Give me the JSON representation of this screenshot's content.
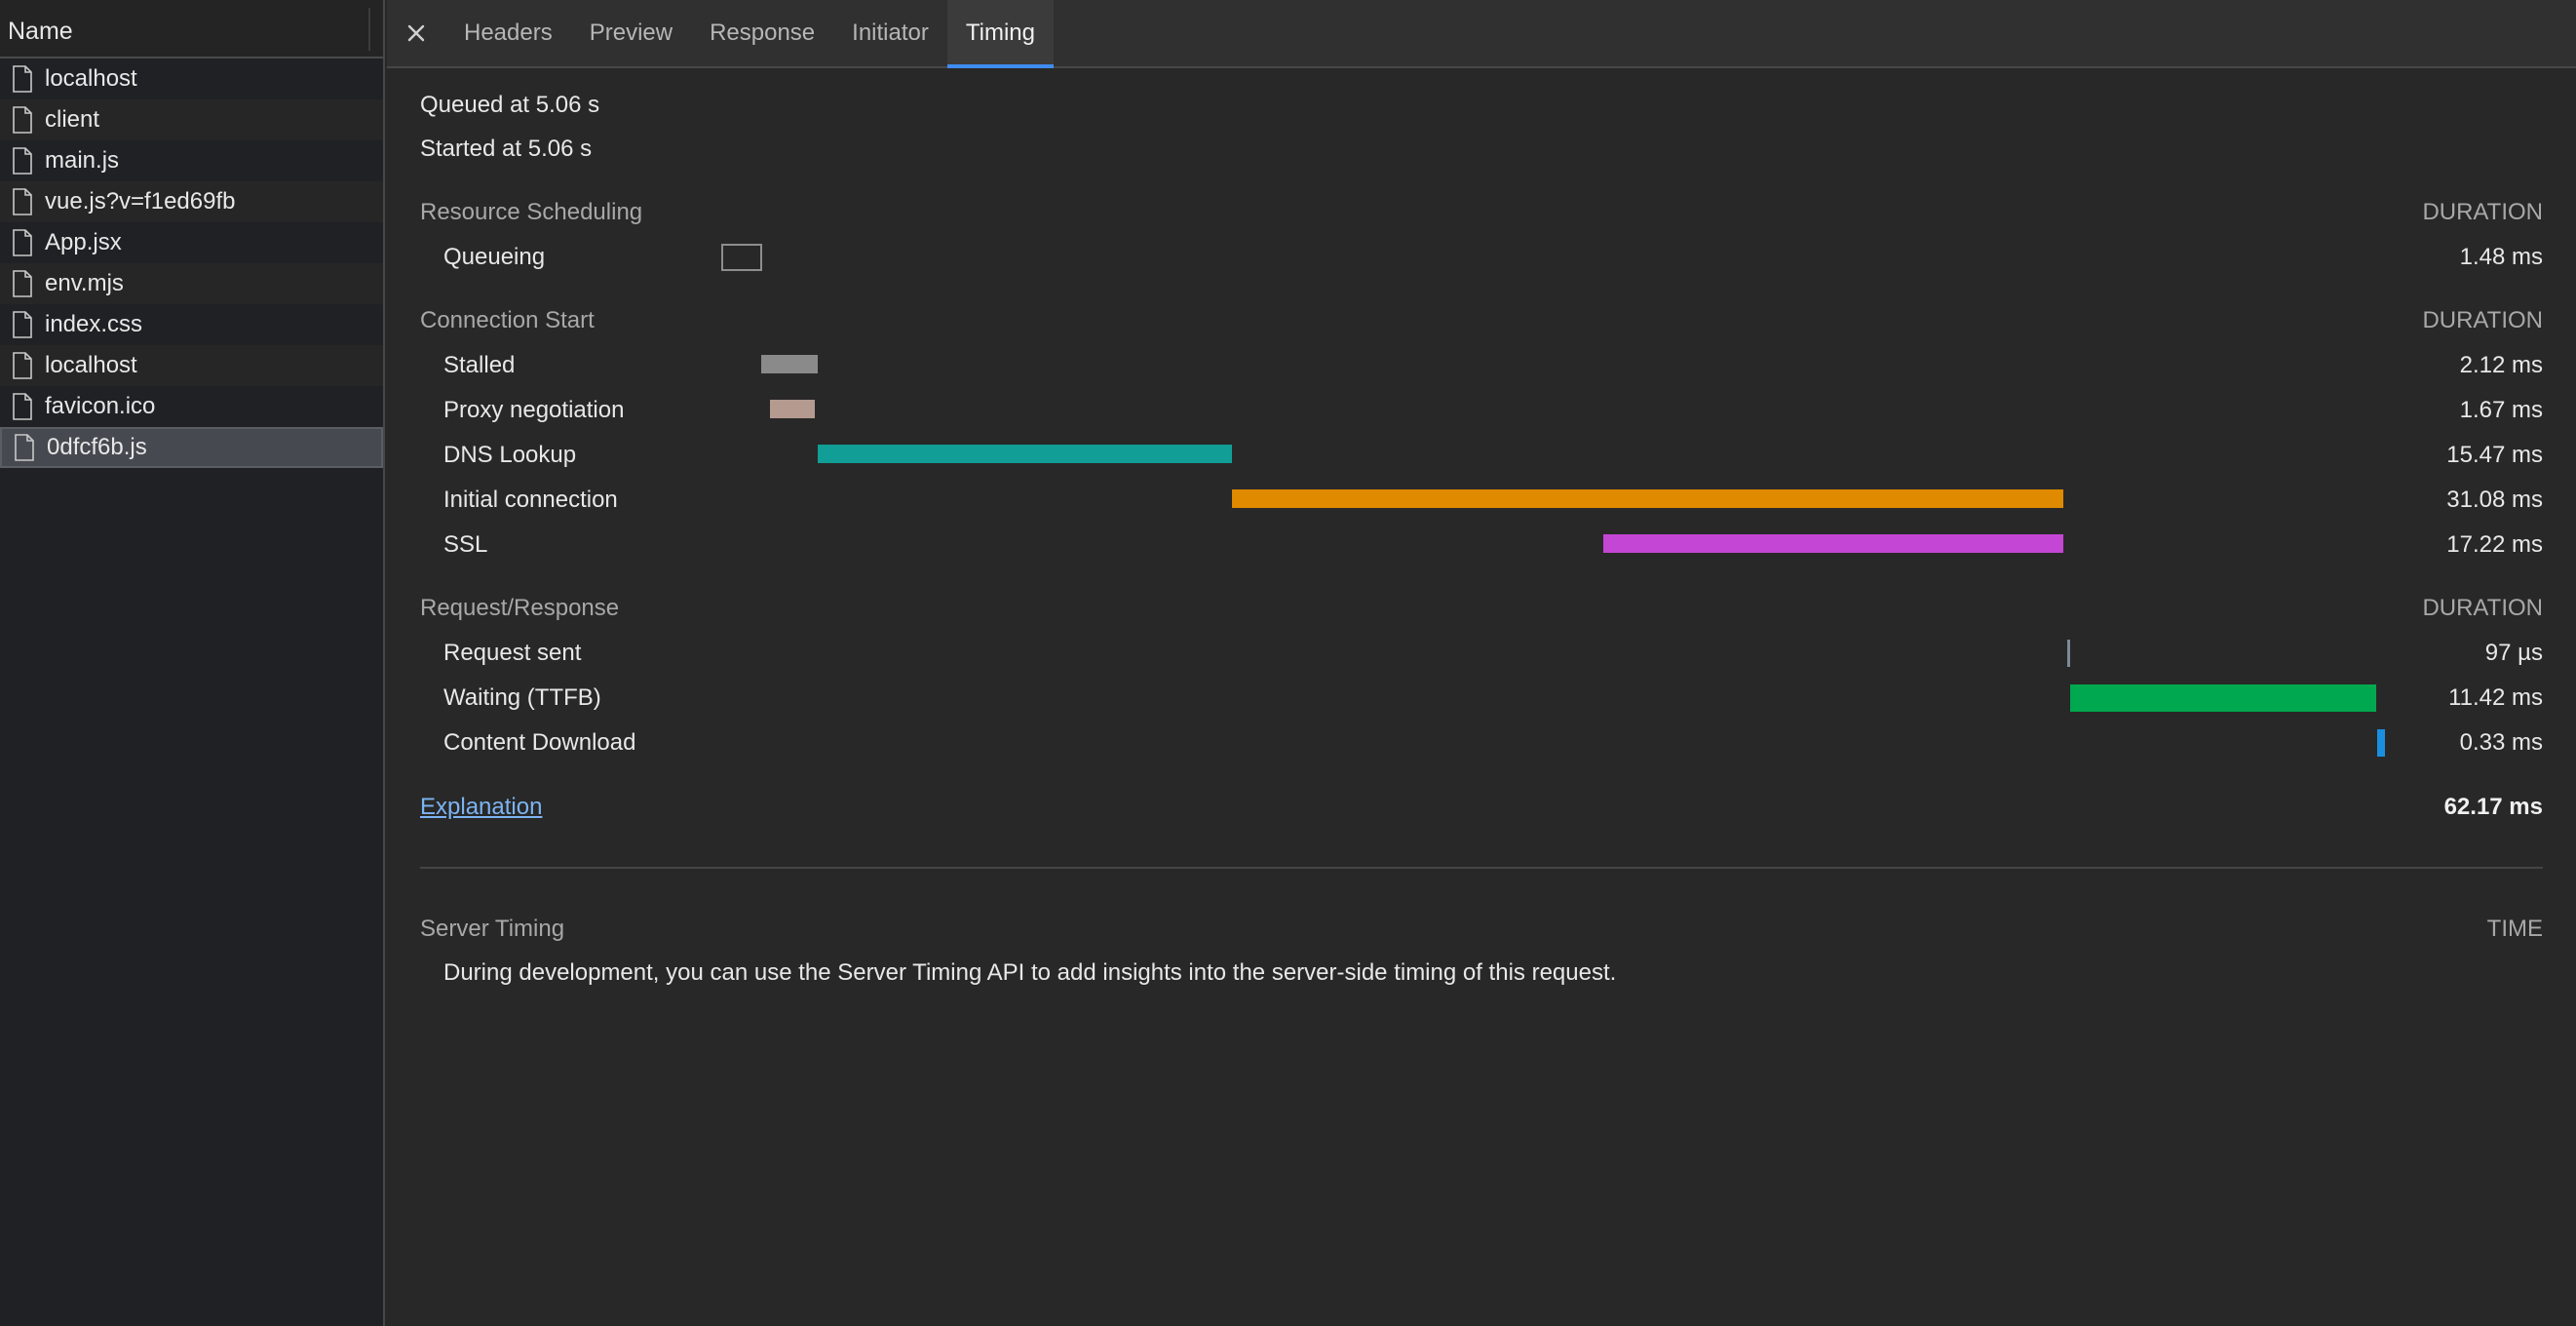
{
  "left_panel": {
    "header": "Name",
    "requests": [
      {
        "name": "localhost"
      },
      {
        "name": "client"
      },
      {
        "name": "main.js"
      },
      {
        "name": "vue.js?v=f1ed69fb"
      },
      {
        "name": "App.jsx"
      },
      {
        "name": "env.mjs"
      },
      {
        "name": "index.css"
      },
      {
        "name": "localhost"
      },
      {
        "name": "favicon.ico"
      },
      {
        "name": "0dfcf6b.js",
        "selected": true
      }
    ]
  },
  "tabs": [
    {
      "label": "Headers"
    },
    {
      "label": "Preview"
    },
    {
      "label": "Response"
    },
    {
      "label": "Initiator"
    },
    {
      "label": "Timing",
      "active": true
    }
  ],
  "timing": {
    "queued_at": "Queued at 5.06 s",
    "started_at": "Started at 5.06 s",
    "sections": [
      {
        "title": "Resource Scheduling",
        "duration_label": "DURATION",
        "rows": [
          {
            "label": "Queueing",
            "value": "1.48 ms"
          }
        ]
      },
      {
        "title": "Connection Start",
        "duration_label": "DURATION",
        "rows": [
          {
            "label": "Stalled",
            "value": "2.12 ms"
          },
          {
            "label": "Proxy negotiation",
            "value": "1.67 ms"
          },
          {
            "label": "DNS Lookup",
            "value": "15.47 ms"
          },
          {
            "label": "Initial connection",
            "value": "31.08 ms"
          },
          {
            "label": "SSL",
            "value": "17.22 ms"
          }
        ]
      },
      {
        "title": "Request/Response",
        "duration_label": "DURATION",
        "rows": [
          {
            "label": "Request sent",
            "value": "97 µs"
          },
          {
            "label": "Waiting (TTFB)",
            "value": "11.42 ms"
          },
          {
            "label": "Content Download",
            "value": "0.33 ms"
          }
        ]
      }
    ],
    "explanation": "Explanation",
    "total": "62.17 ms",
    "colors": {
      "queueing_outline": "#8e8e8e",
      "stalled": "#8a8a8a",
      "proxy": "#b59a90",
      "dns": "#119e96",
      "initial_connection": "#e08a00",
      "ssl": "#c446d4",
      "request_sent": "#7c8a96",
      "waiting": "#00a84f",
      "download": "#1a8fe0"
    }
  },
  "server_timing": {
    "title": "Server Timing",
    "time_label": "TIME",
    "description": "During development, you can use the Server Timing API to add insights into the server-side timing of this request."
  }
}
